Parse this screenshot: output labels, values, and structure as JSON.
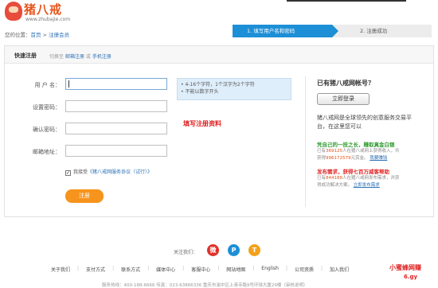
{
  "header": {
    "logo_text": "猪八戒",
    "logo_url": "www.zhubajie.com"
  },
  "breadcrumb": {
    "prefix": "您的位置：",
    "home": "首页",
    "separator": " > ",
    "current": "注册会员"
  },
  "steps": [
    {
      "label": "1. 填写用户名和密码",
      "active": true
    },
    {
      "label": "2. 注册成功",
      "active": false
    }
  ],
  "form": {
    "title": "快速注册",
    "switch_prefix": "切换至",
    "switch_email": "邮箱注册",
    "switch_or": "或",
    "switch_phone": "手机注册",
    "fields": [
      {
        "label": "用 户 名：",
        "value": ""
      },
      {
        "label": "设置密码：",
        "value": ""
      },
      {
        "label": "确认密码：",
        "value": ""
      },
      {
        "label": "邮箱地址：",
        "value": ""
      }
    ],
    "tip_lines": [
      "• 4-16个字符，1个汉字为2个字符",
      "• 不能以数字开头"
    ],
    "annotation": "填写注册资料",
    "agree_prefix": "我接受",
    "agree_link": "《猪八戒网服务协议（试行）》",
    "agree_checked": true,
    "submit": "注册"
  },
  "sidebar": {
    "title": "已有猪八戒网帐号？",
    "login_button": "立即登录",
    "desc": "猪八戒网是全球领先的创意服务交易平台，在这里您可以",
    "sections": [
      {
        "heading": "凭自己的一技之长，赚取真金白银",
        "line1_pre": "已有",
        "line1_num": "369125",
        "line1_post": "人在猪八戒网上获得收入，共",
        "line2_pre": "获得",
        "line2_num": "996172579",
        "line2_post": "元赏金。",
        "link": "我要赚钱"
      },
      {
        "heading": "发布需求，获得七百万威客帮助",
        "line1_pre": "已有",
        "line1_num": "844188",
        "line1_post": "人在猪八戒网发布需求，并获",
        "line2_pre": "得成功解决方案。",
        "line2_num": "",
        "line2_post": "",
        "link": "立即发布需求"
      }
    ]
  },
  "footer": {
    "follow_label": "关注我们：",
    "social": [
      {
        "icon": "weibo-icon",
        "glyph": "微"
      },
      {
        "icon": "qzone-icon",
        "glyph": "P"
      },
      {
        "icon": "tencent-weibo-icon",
        "glyph": "T"
      }
    ],
    "links": [
      "关于我们",
      "支付方式",
      "联系方式",
      "媒体中心",
      "客服中心",
      "网站地图",
      "English",
      "公司资质",
      "加入我们"
    ],
    "small": "服务热线：400-188-6666  传真：023-63866336  重庆市渝中区上清寺路9号环球大厦29楼（审核说明）"
  },
  "watermark": {
    "line1": "小蜜蜂网赚",
    "line2": "6.gy"
  },
  "colors": {
    "accent_blue": "#1d8fd6",
    "brand_orange": "#e8541a",
    "button_orange": "#f7941d",
    "alert_red": "#e02222",
    "success_green": "#2e9a2e"
  }
}
